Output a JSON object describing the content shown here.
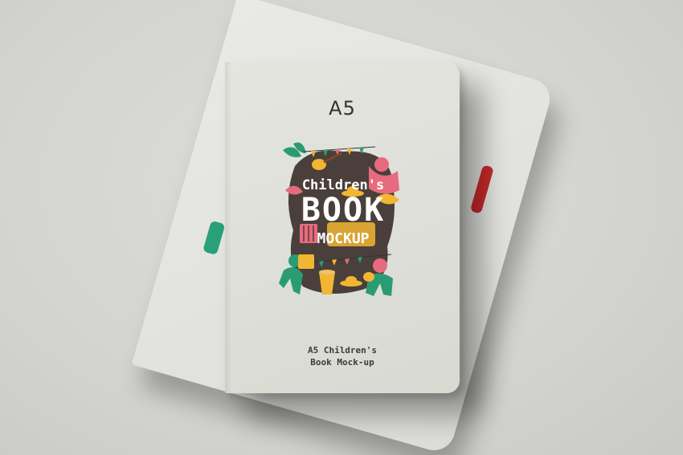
{
  "cover": {
    "size_label": "A5",
    "art_title_line1": "Children's",
    "art_title_line2": "BOOK",
    "art_title_line3": "MOCKUP",
    "subtitle_line1": "A5 Children's",
    "subtitle_line2": "Book Mock-up"
  },
  "colors": {
    "background": "#d4d5d1",
    "cover": "#e2e3dd",
    "art_dark": "#4a3f3a",
    "art_green": "#2a9c74",
    "art_pink": "#e86a7e",
    "art_yellow": "#f2b632",
    "back_book_accent": "#c8282a"
  },
  "icons": [
    "guitar-icon",
    "accordion-icon",
    "drum-icon",
    "hat-icon",
    "leaf-icon",
    "bunting-flags-icon",
    "dancing-figure-icon"
  ]
}
